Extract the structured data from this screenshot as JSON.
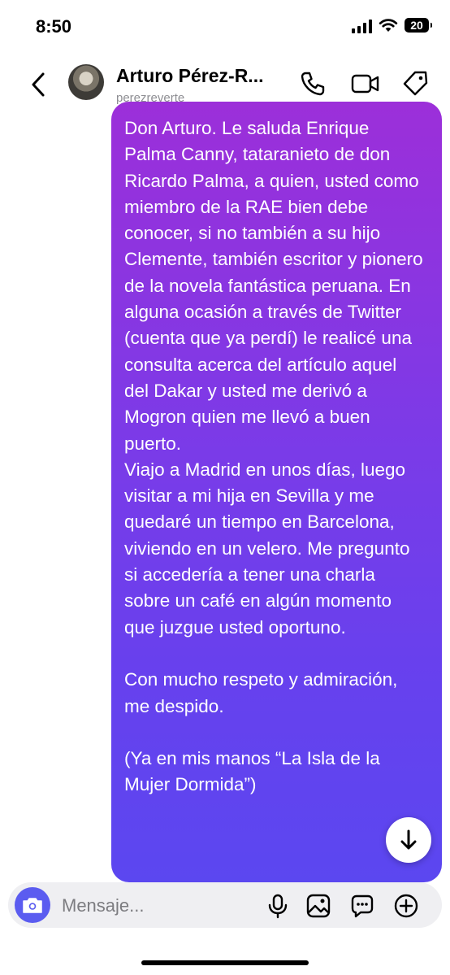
{
  "status_bar": {
    "time": "8:50",
    "battery": "20"
  },
  "header": {
    "title": "Arturo Pérez-R...",
    "username": "perezreverte"
  },
  "message": {
    "paragraphs": [
      "Don Arturo. Le saluda Enrique Palma Canny, tataranieto de don Ricardo Palma, a quien, usted como miembro de la RAE bien debe conocer, si no también a su hijo Clemente, también escritor y pionero de la novela fantástica peruana. En alguna ocasión a través de Twitter (cuenta que ya perdí) le realicé una consulta acerca del artículo aquel del Dakar y usted me derivó a Mogron quien me llevó a buen puerto.",
      "Viajo a Madrid en unos días, luego visitar a mi hija en Sevilla y me quedaré un tiempo en Barcelona, viviendo en un velero. Me pregunto si accedería a tener una charla sobre un café en algún momento que juzgue usted oportuno.",
      "Con mucho respeto y admiración, me despido.",
      "(Ya en mis manos “La Isla de la Mujer Dormida”)"
    ]
  },
  "composer": {
    "placeholder": "Mensaje..."
  },
  "colors": {
    "bubble_top": "#9c2fd9",
    "bubble_bottom": "#5b47f0",
    "camera_button": "#5b5cf0"
  }
}
